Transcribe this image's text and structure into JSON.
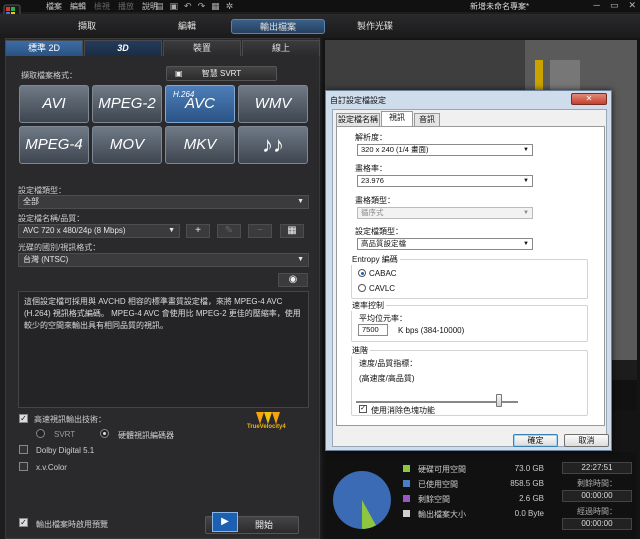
{
  "menubar": {
    "items": [
      "檔案",
      "編輯",
      "檢視",
      "播放",
      "說明"
    ],
    "project_title": "新增未命名專案*",
    "win_controls": [
      "─",
      "▭",
      "✕"
    ]
  },
  "main_tabs": [
    "擷取",
    "編輯",
    "輸出檔案",
    "製作光碟"
  ],
  "sub_tabs": [
    "標準 2D",
    "3D",
    "裝置",
    "線上"
  ],
  "left": {
    "select_format_label": "擷取檔案格式：",
    "svrt_button": "智慧 SVRT",
    "formats": [
      {
        "label": "AVI",
        "sup": ""
      },
      {
        "label": "MPEG-2",
        "sup": ""
      },
      {
        "label": "AVC",
        "sup": "H.264"
      },
      {
        "label": "WMV",
        "sup": ""
      },
      {
        "label": "MPEG-4",
        "sup": ""
      },
      {
        "label": "MOV",
        "sup": ""
      },
      {
        "label": "MKV",
        "sup": ""
      },
      {
        "label": "♪♪",
        "sup": ""
      }
    ],
    "profile_type_label": "設定檔類型：",
    "profile_type_value": "全部",
    "profile_name_label": "設定檔名稱/品質：",
    "profile_name_value": "AVC 720 x 480/24p (8 Mbps)",
    "region_label": "光碟的國別/視訊格式：",
    "region_value": "台灣 (NTSC)",
    "description": "這個設定檔可採用與 AVCHD 相容的標準畫質設定檔，來將 MPEG-4 AVC (H.264) 視訊格式編碼。 MPEG-4 AVC 會使用比 MPEG-2 更佳的壓縮率，使用較少的空間來輸出具有相同品質的視訊。",
    "fast_render_label": "高速視訊輸出技術：",
    "svrt_radio": "SVRT",
    "hw_encoder_radio": "硬體視訊編碼器",
    "dolby_label": "Dolby Digital 5.1",
    "xvcolor_label": "x.v.Color",
    "preview_checkbox_label": "輸出檔案時啟用預覽",
    "start_button": "開始",
    "truvelocity_logo": "TrueVelocity4"
  },
  "dialog": {
    "title": "自訂設定檔設定",
    "close": "✕",
    "tabs": [
      "設定檔名稱",
      "視訊",
      "音訊"
    ],
    "resolution_label": "解析度：",
    "resolution_value": "320 x 240 (1/4 畫面)",
    "framerate_label": "畫格率：",
    "framerate_value": "23.976",
    "frametype_label": "畫格類型：",
    "frametype_value": "循序式",
    "profile_type_label": "設定檔類型：",
    "profile_type_value": "高品質設定檔",
    "entropy_label": "Entropy 編碼",
    "cabac": "CABAC",
    "cavlc": "CAVLC",
    "bitrate_group": "速率控制",
    "avg_bitrate_label": "平均位元率：",
    "avg_bitrate_value": "7500",
    "bitrate_range": "K bps (384-10000)",
    "advanced_group": "進階",
    "speed_quality_label": "速度/品質指標：",
    "speed_quality_hint": "(高速度/高品質)",
    "slider_level": 0.88,
    "deblock_label": "使用消除色塊功能",
    "ok_button": "確定",
    "cancel_button": "取消"
  },
  "disk_stats": {
    "items": [
      {
        "label": "硬碟可用空間",
        "value": "73.0  GB",
        "color": "#8ec63f"
      },
      {
        "label": "已使用空間",
        "value": "858.5  GB",
        "color": "#4a7fc6"
      },
      {
        "label": "剩餘空間",
        "value": "2.6  GB",
        "color": "#9a56c2"
      },
      {
        "label": "輸出檔案大小",
        "value": "0.0  Byte",
        "color": "#cfcfcf"
      }
    ],
    "used_fraction": 0.92
  },
  "times": {
    "current": "22:27:51",
    "remaining_label": "剩餘時間：",
    "remaining": "00:00:00",
    "elapsed_label": "經過時間：",
    "elapsed": "00:00:00"
  }
}
